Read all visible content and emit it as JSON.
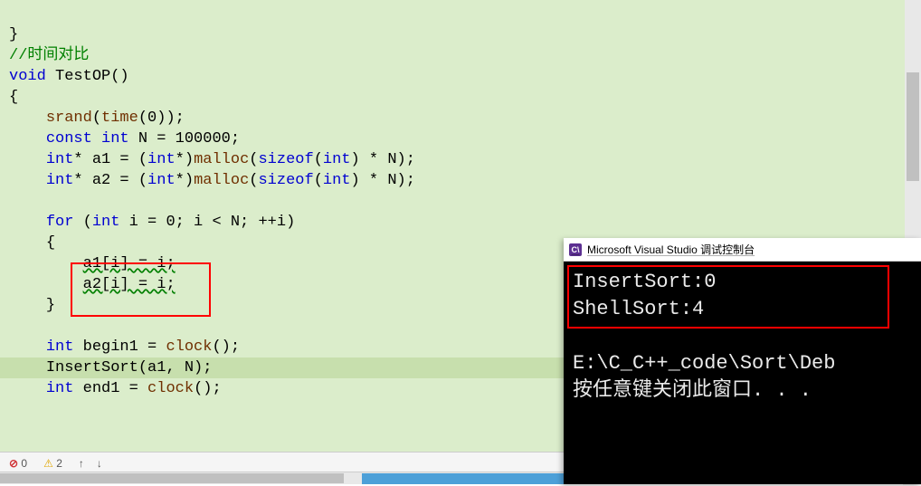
{
  "code": {
    "comment": "//时间对比",
    "l2_void": "void",
    "l2_fn": " TestOP",
    "l2_paren": "()",
    "l3": "{",
    "l4_fn": "srand",
    "l4_open": "(",
    "l4_time": "time",
    "l4_args": "(0));",
    "l5_const": "const ",
    "l5_int": "int",
    "l5_rest": " N = 100000;",
    "l6_int": "int",
    "l6_ptr": "* a1 = (",
    "l6_int2": "int",
    "l6_star": "*)",
    "l6_malloc": "malloc",
    "l6_open": "(",
    "l6_sizeof": "sizeof",
    "l6_args": "(",
    "l6_int3": "int",
    "l6_rest": ") * N);",
    "l7_int": "int",
    "l7_ptr": "* a2 = (",
    "l7_int2": "int",
    "l7_star": "*)",
    "l7_malloc": "malloc",
    "l7_open": "(",
    "l7_sizeof": "sizeof",
    "l7_args": "(",
    "l7_int3": "int",
    "l7_rest": ") * N);",
    "l8_for": "for",
    "l8_open": " (",
    "l8_int": "int",
    "l8_rest": " i = 0; i < N; ++i)",
    "l9": "{",
    "l10": "a1[i] = i;",
    "l11": "a2[i] = i;",
    "l12": "}",
    "l13_int": "int",
    "l13_rest": " begin1 = ",
    "l13_clock": "clock",
    "l13_end": "();",
    "l14_fn": "InsertSort",
    "l14_args": "(a1, N);",
    "l15_int": "int",
    "l15_rest": " end1 = ",
    "l15_clock": "clock",
    "l15_end": "();"
  },
  "statusbar": {
    "errors": "0",
    "warnings": "2",
    "up": "↑",
    "down": "↓"
  },
  "console": {
    "title": "Microsoft Visual Studio 调试控制台",
    "icon_text": "C\\",
    "line1": "InsertSort:0",
    "line2": "ShellSort:4",
    "line3": "E:\\C_C++_code\\Sort\\Deb",
    "line4": "按任意键关闭此窗口. . ."
  }
}
